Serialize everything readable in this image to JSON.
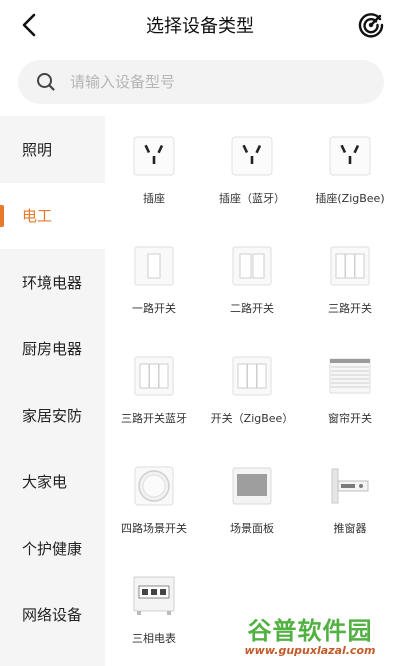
{
  "header": {
    "title": "选择设备类型"
  },
  "search": {
    "placeholder": "请输入设备型号"
  },
  "sidebar": {
    "items": [
      {
        "label": "照明"
      },
      {
        "label": "电工"
      },
      {
        "label": "环境电器"
      },
      {
        "label": "厨房电器"
      },
      {
        "label": "家居安防"
      },
      {
        "label": "大家电"
      },
      {
        "label": "个护健康"
      },
      {
        "label": "网络设备"
      }
    ],
    "active_index": 1
  },
  "devices": [
    {
      "label": "插座",
      "icon": "socket-icon"
    },
    {
      "label": "插座（蓝牙）",
      "icon": "socket-icon"
    },
    {
      "label": "插座(ZigBee)",
      "icon": "socket-icon"
    },
    {
      "label": "一路开关",
      "icon": "one-gang-switch-icon"
    },
    {
      "label": "二路开关",
      "icon": "two-gang-switch-icon"
    },
    {
      "label": "三路开关",
      "icon": "three-gang-switch-icon"
    },
    {
      "label": "三路开关蓝牙",
      "icon": "three-gang-switch-icon"
    },
    {
      "label": "开关（ZigBee）",
      "icon": "three-gang-switch-icon"
    },
    {
      "label": "窗帘开关",
      "icon": "curtain-switch-icon"
    },
    {
      "label": "四路场景开关",
      "icon": "round-scene-switch-icon"
    },
    {
      "label": "场景面板",
      "icon": "scene-panel-icon"
    },
    {
      "label": "推窗器",
      "icon": "window-pusher-icon"
    },
    {
      "label": "三相电表",
      "icon": "electric-meter-icon"
    }
  ],
  "watermark": {
    "title": "谷普软件园",
    "url": "www.gupuxlazal.com"
  },
  "colors": {
    "accent": "#e8782a",
    "sidebar_bg": "#f5f5f5",
    "search_bg": "#f3f3f3"
  }
}
